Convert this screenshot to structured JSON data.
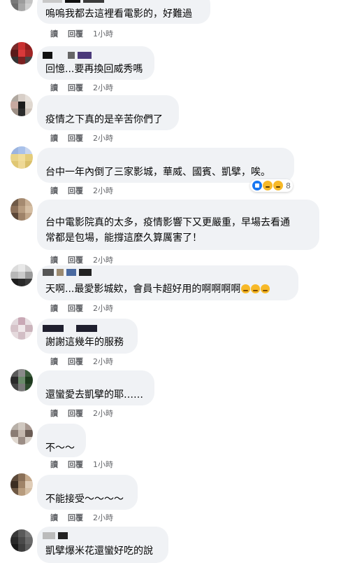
{
  "actions": {
    "read": "讀",
    "reply": "回覆"
  },
  "comments": [
    {
      "text": "嗚嗚我都去這裡看電影的，好難過",
      "time": "1小時"
    },
    {
      "text": "回憶...要再換回威秀嗎",
      "time": "2小時"
    },
    {
      "text": "疫情之下真的是辛苦你們了",
      "time": "2小時"
    },
    {
      "text": "台中一年內倒了三家影城，華威、國賓、凱擘，唉。",
      "time": "2小時",
      "reaction_count": "8",
      "reactions": [
        "like-icon",
        "sad-icon",
        "wow-icon"
      ]
    },
    {
      "text_lines": [
        "台中電影院真的太多，疫情影響下又更嚴重，早場去看通",
        "常都是包場，能撐這麼久算厲害了！"
      ],
      "time": "2小時"
    },
    {
      "text": "天啊...最愛影城欸，會員卡超好用的啊啊啊啊",
      "emojis": [
        "crying-face-emoji",
        "crying-face-emoji",
        "crying-face-emoji"
      ],
      "time": "2小時"
    },
    {
      "text": "謝謝這幾年的服務",
      "time": "2小時"
    },
    {
      "text": "還蠻愛去凱擘的耶……",
      "time": "2小時"
    },
    {
      "text": "不～～",
      "time": "1小時"
    },
    {
      "text": "不能接受～～～～",
      "time": "2小時"
    },
    {
      "text": "凱擘爆米花還蠻好吃的說"
    }
  ],
  "colors": {
    "bubble": "#f0f2f5",
    "meta_text": "#65676b",
    "like": "#1877f2",
    "emoji": "#f7b928"
  }
}
